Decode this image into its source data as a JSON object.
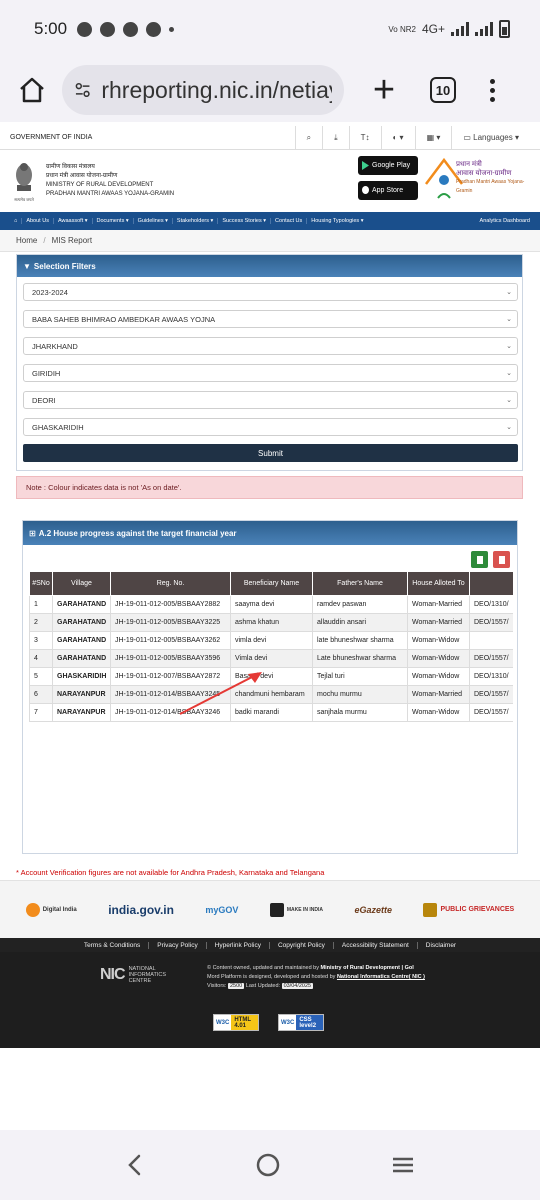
{
  "status": {
    "time": "5:00",
    "carrier": "Vo NR2",
    "network": "4G+"
  },
  "browser": {
    "url": "rhreporting.nic.in/netiay",
    "tab_count": "10"
  },
  "govbar": {
    "label": "GOVERNMENT OF INDIA",
    "languages": "Languages"
  },
  "header": {
    "hindi_ministry": "ग्रामीण विकास मंत्रालय",
    "hindi_scheme": "प्रधान मंत्री आवास योजना-ग्रामीण",
    "ministry": "MINISTRY OF RURAL DEVELOPMENT",
    "scheme": "PRADHAN MANTRI AWAAS YOJANA-GRAMIN",
    "emblem_caption": "सत्यमेव जयते",
    "google_play": "Google Play",
    "app_store": "App Store",
    "pmay_hindi_1": "प्रधान मंत्री",
    "pmay_hindi_2": "आवास योजना-ग्रामीण",
    "pmay_en": "Pradhan Mantri Awaas Yojana-Gramin"
  },
  "nav": {
    "items": [
      "About Us",
      "Awaassoft ▾",
      "Documents ▾",
      "Guidelines ▾",
      "Stakeholders ▾",
      "Success Stories ▾",
      "Contact Us",
      "Housing Typologies ▾"
    ],
    "right": "Analytics Dashboard"
  },
  "breadcrumb": {
    "home": "Home",
    "sep": "/",
    "current": "MIS Report"
  },
  "filters": {
    "title": "Selection Filters",
    "selects": [
      "2023-2024",
      "BABA SAHEB BHIMRAO AMBEDKAR AWAAS YOJNA",
      "JHARKHAND",
      "GIRIDIH",
      "DEORI",
      "GHASKARIDIH"
    ],
    "submit": "Submit"
  },
  "note": "Note : Colour indicates data is not 'As on date'.",
  "progress": {
    "title": "A.2 House progress against the target financial year",
    "columns": [
      "#SNo",
      "Village",
      "Reg. No.",
      "Beneficiary Name",
      "Father's Name",
      "House Alloted To",
      ""
    ],
    "rows": [
      [
        "1",
        "GARAHATAND",
        "JH-19-011-012-005/BSBAAY2882",
        "saayma devi",
        "ramdev paswan",
        "Woman-Married",
        "DEO/1310/"
      ],
      [
        "2",
        "GARAHATAND",
        "JH-19-011-012-005/BSBAAY3225",
        "ashma khatun",
        "allauddin ansari",
        "Woman-Married",
        "DEO/1557/"
      ],
      [
        "3",
        "GARAHATAND",
        "JH-19-011-012-005/BSBAAY3262",
        "vimla devi",
        "late bhuneshwar sharma",
        "Woman-Widow",
        ""
      ],
      [
        "4",
        "GARAHATAND",
        "JH-19-011-012-005/BSBAAY3596",
        "Vimla devi",
        "Late bhuneshwar sharma",
        "Woman-Widow",
        "DEO/1557/"
      ],
      [
        "5",
        "GHASKARIDIH",
        "JH-19-011-012-007/BSBAAY2872",
        "Basanti devi",
        "Tejlal turi",
        "Woman-Widow",
        "DEO/1310/"
      ],
      [
        "6",
        "NARAYANPUR",
        "JH-19-011-012-014/BSBAAY3245",
        "chandmuni hembaram",
        "mochu murmu",
        "Woman-Married",
        "DEO/1557/"
      ],
      [
        "7",
        "NARAYANPUR",
        "JH-19-011-012-014/BSBAAY3246",
        "badki marandi",
        "sanjhala murmu",
        "Woman-Widow",
        "DEO/1557/"
      ]
    ]
  },
  "account_note": "* Account Verification figures are not available for Andhra Pradesh, Karnataka and Telangana",
  "footer": {
    "logos": [
      "Digital India",
      "india.gov.in",
      "myGOV",
      "MAKE IN INDIA",
      "eGazette",
      "PUBLIC GRIEVANCES"
    ],
    "links": [
      "Terms & Conditions",
      "Privacy Policy",
      "Hyperlink Policy",
      "Copyright Policy",
      "Accessibility Statement",
      "Disclaimer"
    ],
    "nic_line1": "NATIONAL",
    "nic_line2": "INFORMATICS",
    "nic_line3": "CENTRE",
    "content_prefix": "© Content owned, updated and maintained by",
    "content_owner": "Ministry of Rural Development | GoI",
    "platform_prefix": "Mord Platform is designed, developed and hosted by",
    "platform_owner": "National Informatics Centre( NIC )",
    "visitors_label": "Visitors:",
    "visitors": "2500",
    "updated_label": "Last Updated:",
    "updated": "03/04/2025",
    "w3c_html": "HTML 4.01",
    "w3c_css": "CSS level2"
  },
  "colors": {
    "nav": "#1a4f8c",
    "panel_head": "#2d5f8e",
    "table_head": "#4f4545",
    "note_bg": "#f8d7da",
    "excel": "#2e8b3a",
    "pdf": "#d9534f"
  }
}
